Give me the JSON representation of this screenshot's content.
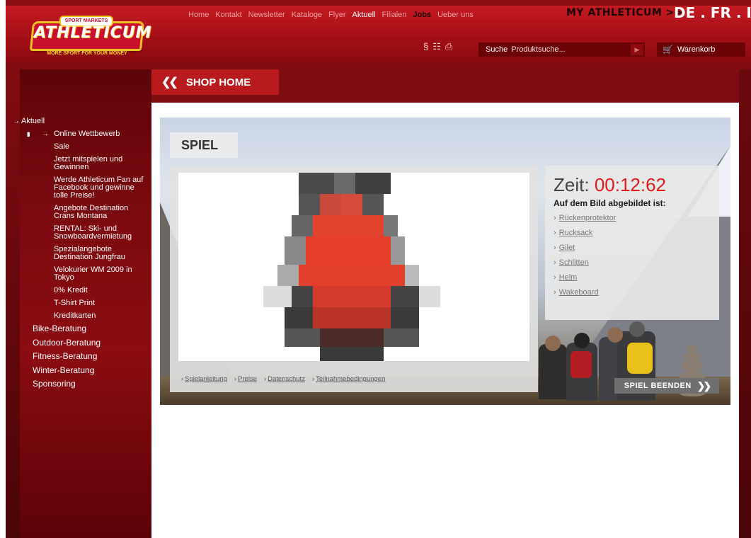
{
  "header": {
    "logo": {
      "badge": "SPORT MARKETS",
      "word": "ATHLETICUM",
      "tagline": "MORE SPORT FOR YOUR MONEY"
    },
    "nav": [
      {
        "label": "Home",
        "style": "normal"
      },
      {
        "label": "Kontakt",
        "style": "normal"
      },
      {
        "label": "Newsletter",
        "style": "normal"
      },
      {
        "label": "Kataloge",
        "style": "normal"
      },
      {
        "label": "Flyer",
        "style": "normal"
      },
      {
        "label": "Aktuell",
        "style": "active"
      },
      {
        "label": "Filialen",
        "style": "normal"
      },
      {
        "label": "Jobs",
        "style": "bold"
      },
      {
        "label": "Ueber uns",
        "style": "normal"
      }
    ],
    "my_athleticum": "MY ATHLETICUM >>",
    "languages": [
      "DE",
      "FR",
      "IT"
    ],
    "lang_sep": " . ",
    "icons": [
      "paragraph-icon",
      "sitemap-icon",
      "print-icon"
    ],
    "search": {
      "label": "Suche",
      "placeholder": "Produktsuche..."
    },
    "cart": {
      "label": "Warenkorb"
    }
  },
  "shop_home": {
    "label": "SHOP HOME",
    "icon": "double-chevron-left-icon"
  },
  "sidebar": {
    "items": [
      {
        "label": "Aktuell",
        "level": 0,
        "marker": "I",
        "arrow": true
      },
      {
        "label": "Online Wettbewerb",
        "level": 1,
        "marker": "I",
        "arrow": true
      },
      {
        "label": "Sale",
        "level": 2
      },
      {
        "label": "Jetzt mitspielen und Gewinnen",
        "level": 2
      },
      {
        "label": "Werde Athleticum Fan auf Facebook und gewinne tolle Preise!",
        "level": 2
      },
      {
        "label": "Angebote Destination Crans Montana",
        "level": 2
      },
      {
        "label": "RENTAL: Ski- und Snowboardvermietung",
        "level": 2
      },
      {
        "label": "Spezialangebote Destination Jungfrau",
        "level": 2
      },
      {
        "label": "Velokurier WM 2009 in Tokyo",
        "level": 2
      },
      {
        "label": "0% Kredit",
        "level": 2
      },
      {
        "label": "T-Shirt Print",
        "level": 2
      },
      {
        "label": "Kreditkarten",
        "level": 2
      },
      {
        "label": "Bike-Beratung",
        "level": 3
      },
      {
        "label": "Outdoor-Beratung",
        "level": 3
      },
      {
        "label": "Fitness-Beratung",
        "level": 3
      },
      {
        "label": "Winter-Beratung",
        "level": 3
      },
      {
        "label": "Sponsoring",
        "level": 3
      }
    ]
  },
  "game": {
    "tab_label": "SPIEL",
    "timer_label": "Zeit:",
    "timer_value": "00:12:62",
    "question": "Auf dem Bild abgebildet ist:",
    "answers": [
      "Rückenprotektor",
      "Rucksack",
      "Gilet",
      "Schlitten",
      "Helm",
      "Wakeboard"
    ],
    "footer_links": [
      "Spielanleitung",
      "Preise",
      "Datenschutz",
      "Teilnahmebedingungen"
    ],
    "end_button": "SPIEL BEENDEN",
    "end_button_icon": "double-chevron-right-icon"
  },
  "colors": {
    "brand_red": "#c51a22",
    "dark_red": "#6a0206",
    "timer_red": "#e11b1b",
    "accent_yellow": "#f4c21f"
  }
}
